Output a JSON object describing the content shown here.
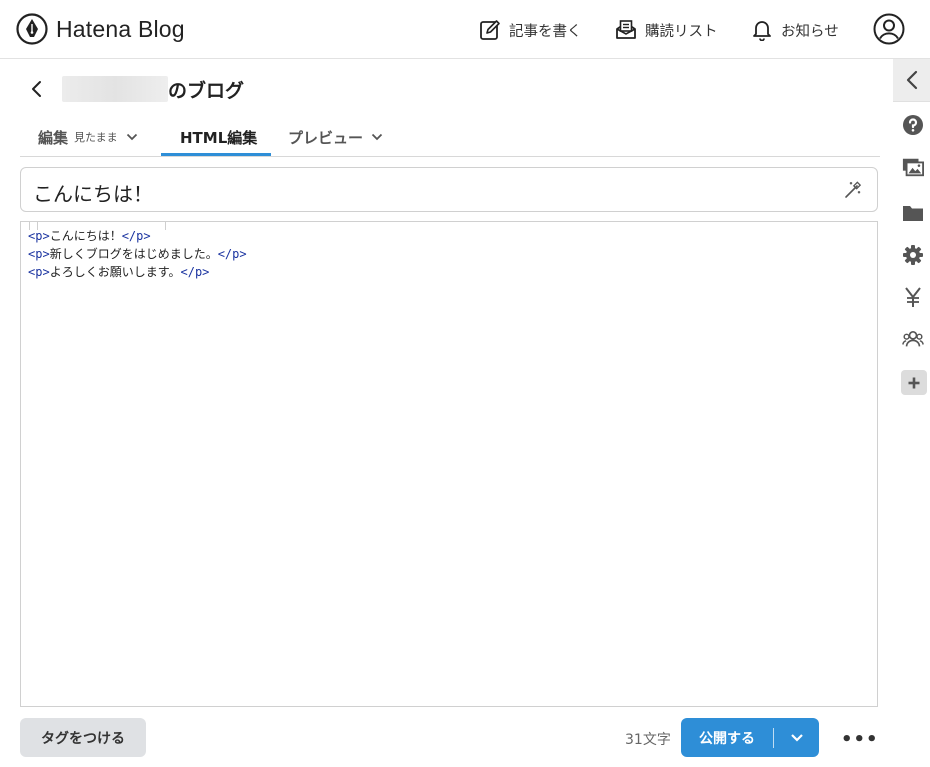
{
  "header": {
    "logo_text": "Hatena Blog",
    "nav": [
      {
        "label": "記事を書く",
        "icon": "write-icon"
      },
      {
        "label": "購読リスト",
        "icon": "subscription-icon"
      },
      {
        "label": "お知らせ",
        "icon": "bell-icon"
      }
    ]
  },
  "blog": {
    "name_suffix": "のブログ"
  },
  "tabs": [
    {
      "label": "編集",
      "sub": "見たまま"
    },
    {
      "label": "HTML編集"
    },
    {
      "label": "プレビュー"
    }
  ],
  "title": {
    "value": "こんにちは！"
  },
  "editor": {
    "lines": [
      {
        "open": "<p>",
        "text": "こんにちは！",
        "close": "</p>"
      },
      {
        "open": "<p>",
        "text": "新しくブログをはじめました。",
        "close": "</p>"
      },
      {
        "open": "<p>",
        "text": "よろしくお願いします。",
        "close": "</p>"
      }
    ]
  },
  "footer": {
    "tag_button": "タグをつける",
    "char_count": "31文字",
    "publish_button": "公開する",
    "more": "•••"
  },
  "sidebar": {
    "icons": [
      "help-icon",
      "images-icon",
      "folder-icon",
      "settings-icon",
      "yen-icon",
      "users-icon",
      "plus-icon"
    ]
  },
  "colors": {
    "accent": "#2e8ed7",
    "tag_code": "#1a33a0"
  }
}
